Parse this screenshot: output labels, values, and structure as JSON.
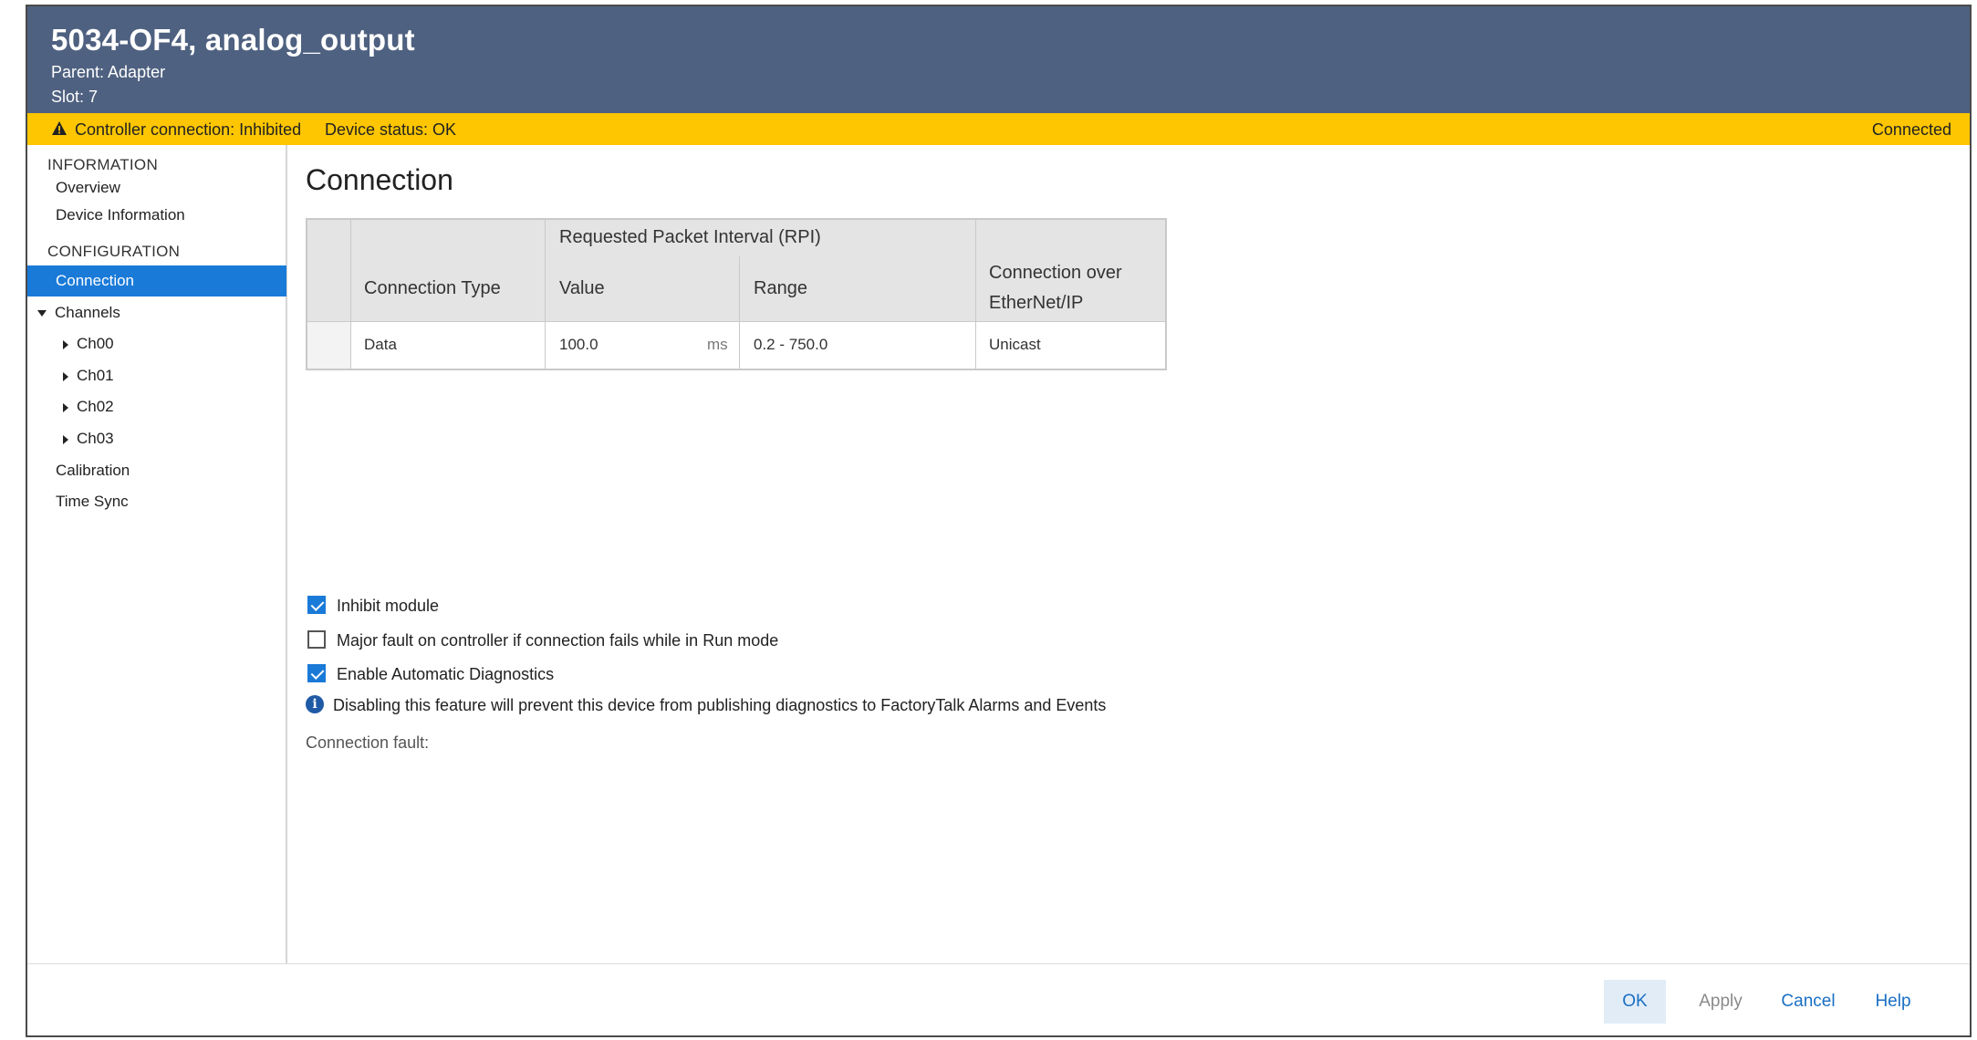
{
  "header": {
    "title": "5034-OF4, analog_output",
    "parent": "Parent: Adapter",
    "slot": "Slot: 7"
  },
  "status": {
    "controller_connection": "Controller connection: Inhibited",
    "device_status": "Device status: OK",
    "connection_state": "Connected",
    "bar_color": "#fdc600"
  },
  "sidebar": {
    "information_heading": "INFORMATION",
    "overview": "Overview",
    "device_information": "Device Information",
    "configuration_heading": "CONFIGURATION",
    "connection": "Connection",
    "channels": "Channels",
    "channel_items": [
      "Ch00",
      "Ch01",
      "Ch02",
      "Ch03"
    ],
    "calibration": "Calibration",
    "time_sync": "Time Sync"
  },
  "main": {
    "page_title": "Connection",
    "table": {
      "rpi_header": "Requested Packet Interval (RPI)",
      "col_connection_type": "Connection Type",
      "col_value": "Value",
      "col_range": "Range",
      "col_connection_over_1": "Connection over",
      "col_connection_over_2": "EtherNet/IP",
      "row": {
        "connection_type": "Data",
        "value": "100.0",
        "unit": "ms",
        "range": "0.2 - 750.0",
        "connection_over": "Unicast"
      }
    },
    "options": {
      "inhibit_module": "Inhibit module",
      "inhibit_module_checked": true,
      "major_fault": "Major fault on controller if connection fails while in Run mode",
      "major_fault_checked": false,
      "auto_diagnostics": "Enable Automatic Diagnostics",
      "auto_diagnostics_checked": true
    },
    "info_text": "Disabling this feature will prevent this device from publishing diagnostics to FactoryTalk Alarms and Events",
    "connection_fault_label": "Connection fault:"
  },
  "footer": {
    "ok": "OK",
    "apply": "Apply",
    "cancel": "Cancel",
    "help": "Help"
  },
  "colors": {
    "header": "#4f6180",
    "accent": "#1a7ad8"
  }
}
